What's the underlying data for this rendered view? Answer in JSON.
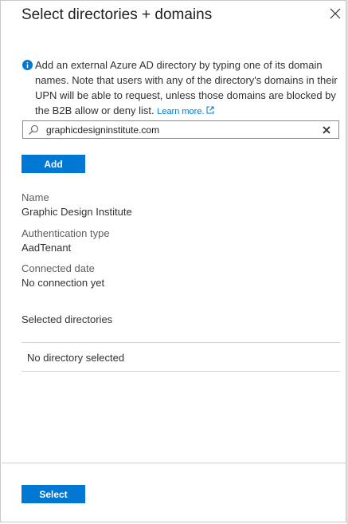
{
  "panel": {
    "title": "Select directories + domains"
  },
  "info": {
    "text": "Add an external Azure AD directory by typing one of its domain names. Note that users with any of the directory's domains in their UPN will be able to request, unless those domains are blocked by the B2B allow or deny list.",
    "learn_more": "Learn more."
  },
  "search": {
    "value": "graphicdesigninstitute.com"
  },
  "add_button": "Add",
  "details": {
    "name_label": "Name",
    "name_value": "Graphic Design Institute",
    "auth_label": "Authentication type",
    "auth_value": "AadTenant",
    "connected_label": "Connected date",
    "connected_value": "No connection yet"
  },
  "selected": {
    "title": "Selected directories",
    "empty_text": "No directory selected"
  },
  "select_button": "Select",
  "colors": {
    "accent": "#0078d4",
    "text": "#323130",
    "muted": "#605e5c"
  }
}
